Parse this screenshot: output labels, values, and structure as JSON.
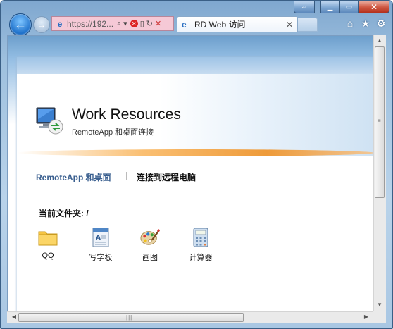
{
  "browser": {
    "address_url": "https://192...",
    "tab_title": "RD Web 访问"
  },
  "page": {
    "title": "Work Resources",
    "subtitle": "RemoteApp 和桌面连接",
    "nav": {
      "remoteapp": "RemoteApp 和桌面",
      "connect": "连接到远程电脑"
    },
    "current_folder_label": "当前文件夹: /",
    "apps": [
      {
        "label": "QQ",
        "icon": "folder-icon"
      },
      {
        "label": "写字板",
        "icon": "wordpad-icon"
      },
      {
        "label": "画图",
        "icon": "paint-icon"
      },
      {
        "label": "计算器",
        "icon": "calculator-icon"
      }
    ]
  },
  "colors": {
    "nav_active": "#3a5f8f",
    "accent_orange": "#ef8b17",
    "address_error_bg": "#f5c9d6"
  }
}
